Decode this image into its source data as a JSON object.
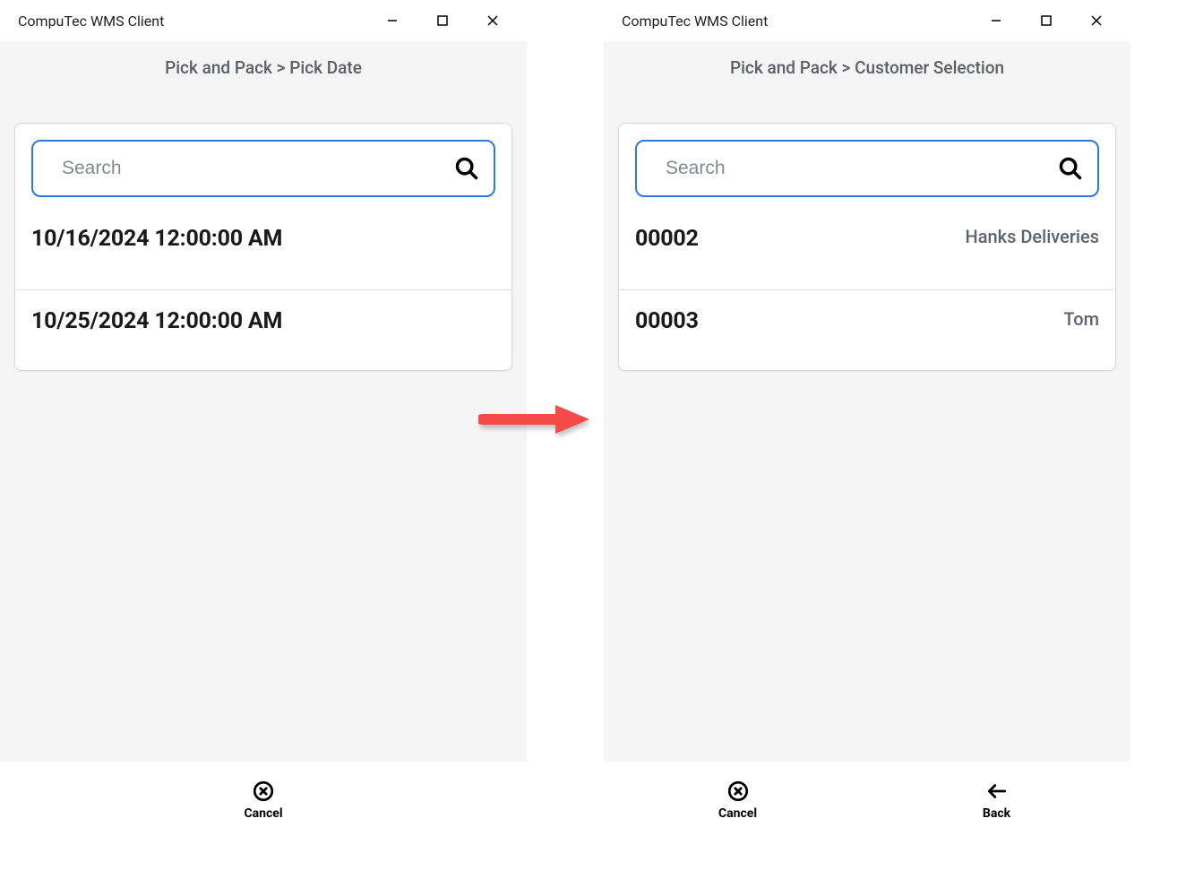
{
  "left_window": {
    "title": "CompuTec WMS Client",
    "breadcrumb": "Pick and Pack > Pick Date",
    "search_placeholder": "Search",
    "rows": [
      {
        "primary": "10/16/2024 12:00:00 AM"
      },
      {
        "primary": "10/25/2024 12:00:00 AM"
      }
    ],
    "bottom": {
      "cancel_label": "Cancel"
    }
  },
  "right_window": {
    "title": "CompuTec WMS Client",
    "breadcrumb": "Pick and Pack > Customer Selection",
    "search_placeholder": "Search",
    "rows": [
      {
        "primary": "00002",
        "secondary": "Hanks Deliveries"
      },
      {
        "primary": "00003",
        "secondary": "Tom"
      }
    ],
    "bottom": {
      "cancel_label": "Cancel",
      "back_label": "Back"
    }
  }
}
